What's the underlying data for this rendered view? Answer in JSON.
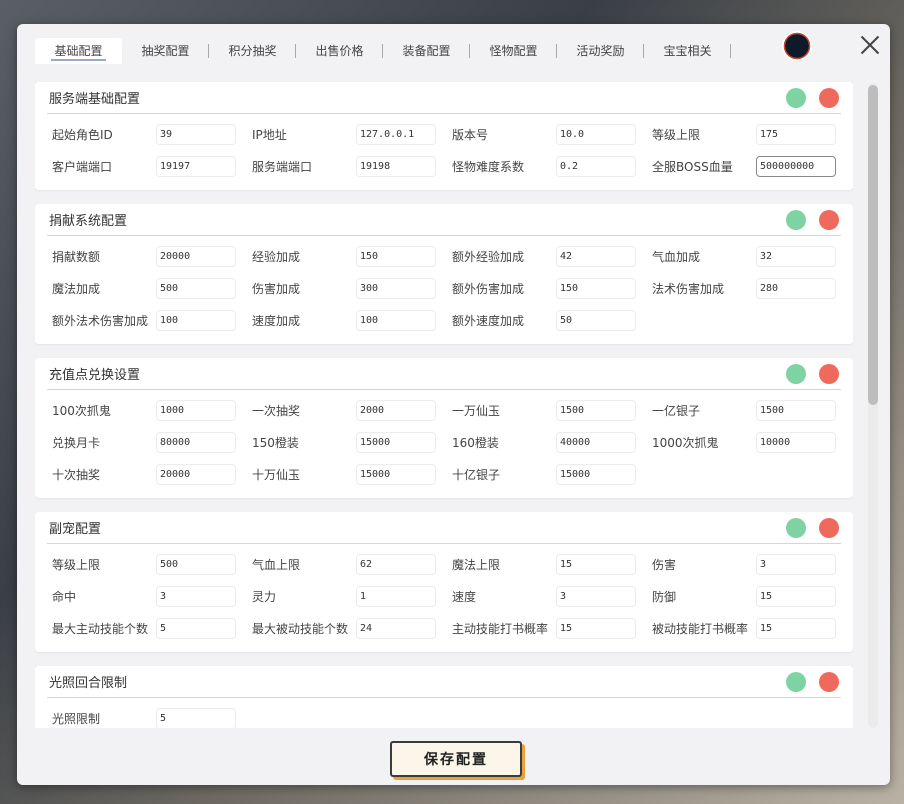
{
  "tabs": [
    "基础配置",
    "抽奖配置",
    "积分抽奖",
    "出售价格",
    "装备配置",
    "怪物配置",
    "活动奖励",
    "宝宝相关"
  ],
  "active_tab": 0,
  "sections": [
    {
      "title": "服务端基础配置",
      "fields": [
        {
          "label": "起始角色ID",
          "value": "39"
        },
        {
          "label": "IP地址",
          "value": "127.0.0.1"
        },
        {
          "label": "版本号",
          "value": "10.0"
        },
        {
          "label": "等级上限",
          "value": "175"
        },
        {
          "label": "客户端端口",
          "value": "19197"
        },
        {
          "label": "服务端端口",
          "value": "19198"
        },
        {
          "label": "怪物难度系数",
          "value": "0.2"
        },
        {
          "label": "全服BOSS血量",
          "value": "500000000"
        }
      ]
    },
    {
      "title": "捐献系统配置",
      "fields": [
        {
          "label": "捐献数额",
          "value": "20000"
        },
        {
          "label": "经验加成",
          "value": "150"
        },
        {
          "label": "额外经验加成",
          "value": "42"
        },
        {
          "label": "气血加成",
          "value": "32"
        },
        {
          "label": "魔法加成",
          "value": "500"
        },
        {
          "label": "伤害加成",
          "value": "300"
        },
        {
          "label": "额外伤害加成",
          "value": "150"
        },
        {
          "label": "法术伤害加成",
          "value": "280"
        },
        {
          "label": "额外法术伤害加成",
          "value": "100"
        },
        {
          "label": "速度加成",
          "value": "100"
        },
        {
          "label": "额外速度加成",
          "value": "50"
        }
      ]
    },
    {
      "title": "充值点兑换设置",
      "fields": [
        {
          "label": "100次抓鬼",
          "value": "1000"
        },
        {
          "label": "一次抽奖",
          "value": "2000"
        },
        {
          "label": "一万仙玉",
          "value": "1500"
        },
        {
          "label": "一亿银子",
          "value": "1500"
        },
        {
          "label": "兑换月卡",
          "value": "80000"
        },
        {
          "label": "150橙装",
          "value": "15000"
        },
        {
          "label": "160橙装",
          "value": "40000"
        },
        {
          "label": "1000次抓鬼",
          "value": "10000"
        },
        {
          "label": "十次抽奖",
          "value": "20000"
        },
        {
          "label": "十万仙玉",
          "value": "15000"
        },
        {
          "label": "十亿银子",
          "value": "15000"
        }
      ]
    },
    {
      "title": "副宠配置",
      "fields": [
        {
          "label": "等级上限",
          "value": "500"
        },
        {
          "label": "气血上限",
          "value": "62"
        },
        {
          "label": "魔法上限",
          "value": "15"
        },
        {
          "label": "伤害",
          "value": "3"
        },
        {
          "label": "命中",
          "value": "3"
        },
        {
          "label": "灵力",
          "value": "1"
        },
        {
          "label": "速度",
          "value": "3"
        },
        {
          "label": "防御",
          "value": "15"
        },
        {
          "label": "最大主动技能个数",
          "value": "5"
        },
        {
          "label": "最大被动技能个数",
          "value": "24"
        },
        {
          "label": "主动技能打书概率",
          "value": "15"
        },
        {
          "label": "被动技能打书概率",
          "value": "15"
        }
      ]
    },
    {
      "title": "光照回合限制",
      "fields": [
        {
          "label": "光照限制",
          "value": "5"
        }
      ]
    }
  ],
  "save_label": "保存配置",
  "colors": {
    "confirm": "#7fd3a2",
    "cancel": "#ef6a5c",
    "accent": "#e7a23b"
  },
  "icons": {
    "confirm": "green-circle-icon",
    "cancel": "red-circle-icon",
    "close": "close-icon"
  }
}
